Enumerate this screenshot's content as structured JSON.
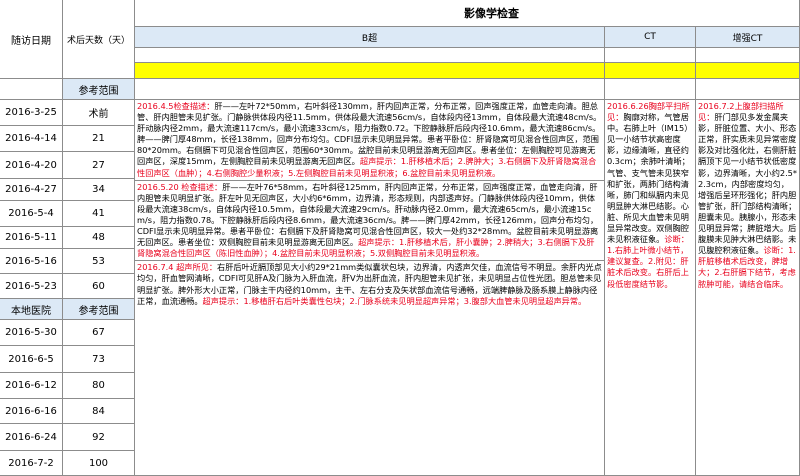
{
  "header": {
    "title": "影像学检查",
    "col_followup": "随访日期",
    "col_days": "术后天数（天）",
    "col_bmode": "B超",
    "col_ct": "CT",
    "col_enhanced_ct": "增强CT",
    "reference_range": "参考范围",
    "local_hospital": "本地医院"
  },
  "rows": [
    {
      "date": "2016-3-25",
      "days": "术前"
    },
    {
      "date": "2016-4-14",
      "days": "21"
    },
    {
      "date": "2016-4-20",
      "days": "27"
    },
    {
      "date": "2016-4-27",
      "days": "34"
    },
    {
      "date": "2016-5-4",
      "days": "41"
    },
    {
      "date": "2016-5-11",
      "days": "48"
    },
    {
      "date": "2016-5-16",
      "days": "53"
    },
    {
      "date": "2016-5-23",
      "days": "60"
    },
    {
      "date": "2016-5-30",
      "days": "67"
    },
    {
      "date": "2016-6-5",
      "days": "73"
    },
    {
      "date": "2016-6-12",
      "days": "80"
    },
    {
      "date": "2016-6-16",
      "days": "84"
    },
    {
      "date": "2016-6-24",
      "days": "92"
    },
    {
      "date": "2016-7-2",
      "days": "100"
    }
  ],
  "bmode": {
    "r1_head": "2016.4.5检查描述：",
    "r1_body": "肝——左叶72*50mm，右叶斜径130mm，肝内回声正常，分布正常，回声强度正常，血管走向清。胆总管、肝内胆管未见扩张。门静脉供体段内径11.5mm，供体段最大流速56cm/s，自体段内径13mm，自体段最大流速48cm/s。肝动脉内径2mm，最大流速117cm/s，最小流速33cm/s，阻力指数0.72。下腔静脉肝后段内径10.6mm，最大流速86cm/s。脾——脾门厚48mm，长径138mm，回声分布均匀。CDFI显示未见明显异常。患者平卧位：肝肾隐窝可见混合性回声区，范围80*20mm。右侧膈下可见混合性回声区，范围60*30mm。盆腔目前未见明显游离无回声区。患者坐位：左侧胸腔可见游离无回声区，深度15mm，左侧胸腔目前未见明显游离无回声区。",
    "r1_hint": "超声提示：1.肝移植术后；2.脾肿大；3.右侧膈下及肝肾隐窝混合性回声区（血肿）；4.右侧胸腔少量积液；5.左侧胸腔目前未见明显积液；6.盆腔目前未见明显积液。",
    "r2_head": "2016.5.20 检查描述：",
    "r2_body": "肝——左叶76*58mm，右叶斜径125mm，肝内回声正常，分布正常，回声强度正常，血管走向清，肝内胆管未见明显扩张。肝左叶见无回声区，大小约6*6mm，边界清，形态规则，内部透声好。门静脉供体段内径10mm，供体段最大流速38cm/s，自体段内径10.5mm，自体段最大流速29cm/s。肝动脉内径2.0mm，最大流速65cm/s，最小流速15cm/s，阻力指数0.78。下腔静脉肝后段内径8.6mm，最大流速36cm/s。脾——脾门厚42mm，长径126mm，回声分布均匀，CDFI显示未见明显异常。患者平卧位：右侧膈下及肝肾隐窝可见混合性回声区，较大一处约32*28mm。盆腔目前未见明显游离无回声区。患者坐位：双侧胸腔目前未见明显游离无回声区。",
    "r2_hint": "超声提示：1.肝移植术后，肝小囊肿；2.脾稍大；3.右侧膈下及肝肾隐窝混合性回声区（陈旧性血肿）；4.盆腔目前未见明显积液；5.双侧胸腔目前未见明显积液。",
    "r3_head": "2016.7.4 超声所见：",
    "r3_body": "右肝后叶近膈顶部见大小约29*21mm类似囊状包块，边界清，内透声欠佳，血流信号不明显。余肝内光点均匀，肝血管网清晰，CDFI可见肝A及门脉为入肝血流，肝V为出肝血流，肝内胆管未见扩张，未见明显占位性光团。胆总管未见明显扩张。脾外形大小正常，门脉主干内径约10mm，主干、左右分支及矢状部血流信号通畅，远端脾静脉及肠系膜上静脉内径正常，血流通畅。",
    "r3_hint": "超声提示：1.移植肝右后叶类囊性包块；2.门脉系统未见明显超声异常；3.腹部大血管未见明显超声异常。"
  },
  "ct": {
    "head": "2016.6.26胸部平扫所见：",
    "body": "胸廓对称，气管居中。右肺上叶（IM15）见一小结节状高密度影，边缘清晰，直径约0.3cm；余肺叶清晰；气管、支气管未见狭窄和扩张，两肺门结构清晰，肺门和纵膈内未见明显肿大淋巴结影。心脏、所见大血管未见明显异常改变。双侧胸腔未见积液征象。",
    "diag_head": "诊断：1.右肺上叶微小结节，建议复查。",
    "diag2": "2.附见：肝脏术后改变。右肝后上段低密度结节影。"
  },
  "enhanced_ct": {
    "head": "2016.7.2上腹部扫描所见：",
    "body": "肝门部见多发金属夹影，肝脏位置、大小、形态正常，肝实质未见异常密度影及对比强化灶，右侧肝脏膈顶下见一小结节状低密度影，边界清晰，大小约2.5*2.3cm，内部密度均匀，增强后呈环形强化；肝内胆管扩张，肝门部结构清晰；胆囊未见。胰腺小，形态未见明显异常；脾脏增大。后腹膜未见肿大淋巴结影。未见腹腔积液征象。",
    "diag_head": "诊断：1.肝脏移植术后改变，脾增大；2.右肝膈下结节，考虑脓肿可能，请结合临床。"
  },
  "colors": {
    "header_blue": "#dce9f6",
    "highlight_yellow": "#ffff00",
    "finding_red": "#e8001c",
    "grid": "#8c8c8c"
  }
}
